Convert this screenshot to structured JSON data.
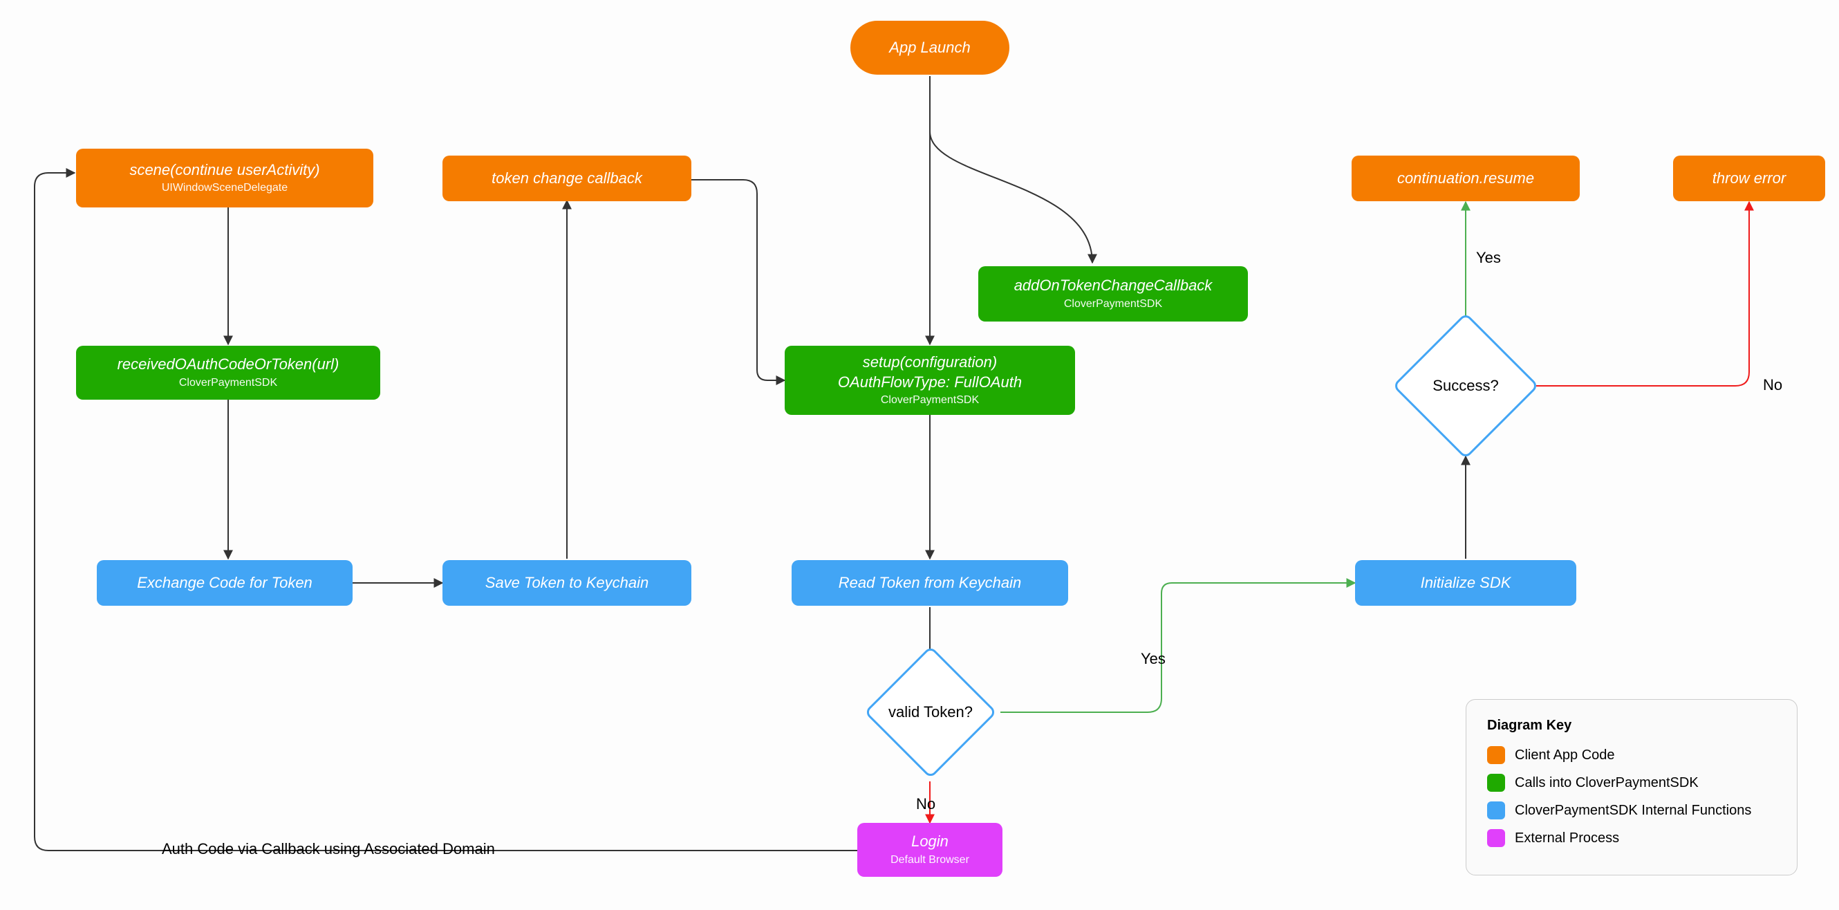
{
  "nodes": {
    "app_launch": {
      "title": "App Launch"
    },
    "scene": {
      "title": "scene(continue userActivity)",
      "sub": "UIWindowSceneDelegate"
    },
    "token_change_cb": {
      "title": "token change callback"
    },
    "continuation_resume": {
      "title": "continuation.resume"
    },
    "throw_error": {
      "title": "throw error"
    },
    "add_on_token": {
      "title": "addOnTokenChangeCallback",
      "sub": "CloverPaymentSDK"
    },
    "received_oauth": {
      "title": "receivedOAuthCodeOrToken(url)",
      "sub": "CloverPaymentSDK"
    },
    "setup_config": {
      "title": "setup(configuration)\nOAuthFlowType: FullOAuth",
      "sub": "CloverPaymentSDK"
    },
    "exchange_code": {
      "title": "Exchange Code for Token"
    },
    "save_token": {
      "title": "Save Token to Keychain"
    },
    "read_token": {
      "title": "Read Token from Keychain"
    },
    "initialize_sdk": {
      "title": "Initialize SDK"
    },
    "login": {
      "title": "Login",
      "sub": "Default Browser"
    },
    "valid_token_q": {
      "label": "valid Token?"
    },
    "success_q": {
      "label": "Success?"
    }
  },
  "edge_labels": {
    "valid_yes": "Yes",
    "valid_no": "No",
    "success_yes": "Yes",
    "success_no": "No",
    "auth_callback": "Auth Code via Callback using Associated Domain"
  },
  "legend": {
    "title": "Diagram Key",
    "items": [
      {
        "color": "orange",
        "label": "Client App Code"
      },
      {
        "color": "green",
        "label": "Calls into CloverPaymentSDK"
      },
      {
        "color": "blue",
        "label": "CloverPaymentSDK Internal Functions"
      },
      {
        "color": "violet",
        "label": "External Process"
      }
    ]
  },
  "colors": {
    "orange": "#f57c00",
    "green": "#1faa00",
    "blue": "#42a5f5",
    "violet": "#e040fb",
    "edge_black": "#333333",
    "edge_green": "#4caf50",
    "edge_red": "#ef1b1b"
  }
}
